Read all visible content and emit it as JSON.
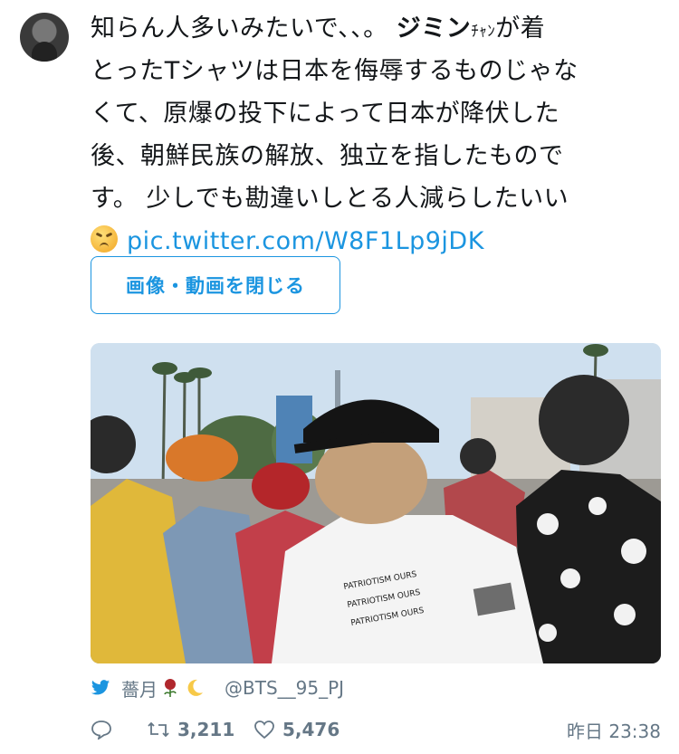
{
  "tweet": {
    "lines": [
      {
        "pre": "知らん人多いみたいで、、。",
        "bold": "ジミン",
        "small": "ﾁｬﾝ",
        "post": "が着"
      },
      {
        "text": "とったTシャツは日本を侮辱するものじゃな"
      },
      {
        "text": "くて、原爆の投下によって日本が降伏した"
      },
      {
        "text": "後、朝鮮民族の解放、独立を指したもので"
      },
      {
        "text": "す。 少しでも勘違いしとる人減らしたいい"
      }
    ],
    "link_text": "pic.twitter.com/W8F1Lp9jDK",
    "emoji": "persevering-face-emoji"
  },
  "media": {
    "close_button_label": "画像・動画を閉じる",
    "shirt_text": [
      "PATRIOTISM OURS",
      "PATRIOTISM OURS",
      "PATRIOTISM OURS"
    ]
  },
  "user": {
    "display_name": "薔月",
    "handle": "@BTS__95_PJ"
  },
  "actions": {
    "retweets": "3,211",
    "likes": "5,476",
    "timestamp": "昨日 23:38"
  },
  "colors": {
    "accent": "#1b95e0",
    "muted": "#657786",
    "text": "#14171a"
  }
}
